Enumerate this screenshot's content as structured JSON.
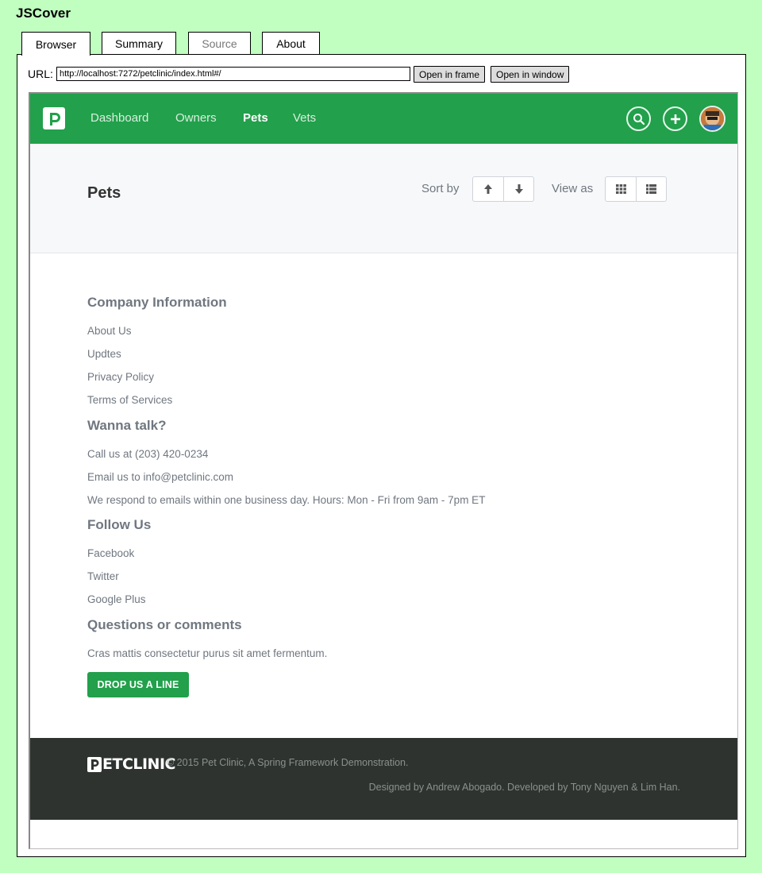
{
  "app_title": "JSCover",
  "tabs": [
    {
      "label": "Browser",
      "state": "active"
    },
    {
      "label": "Summary",
      "state": "normal"
    },
    {
      "label": "Source",
      "state": "disabled"
    },
    {
      "label": "About",
      "state": "normal"
    }
  ],
  "toolbar": {
    "url_label": "URL:",
    "url_value": "http://localhost:7272/petclinic/index.html#/",
    "open_frame_label": "Open in frame",
    "open_window_label": "Open in window"
  },
  "site": {
    "brand_color": "#22a04b",
    "nav": {
      "links": [
        "Dashboard",
        "Owners",
        "Pets",
        "Vets"
      ],
      "active": "Pets",
      "icons": [
        "search-icon",
        "plus-icon",
        "user-avatar"
      ]
    },
    "header": {
      "title": "Pets",
      "sort_label": "Sort by",
      "view_label": "View as",
      "sort_icons": [
        "arrow-up-icon",
        "arrow-down-icon"
      ],
      "view_icons": [
        "grid-view-icon",
        "list-view-icon"
      ]
    },
    "footer": {
      "company": {
        "heading": "Company Information",
        "links": [
          "About Us",
          "Updtes",
          "Privacy Policy",
          "Terms of Services"
        ]
      },
      "talk": {
        "heading": "Wanna talk?",
        "lines": [
          "Call us at (203) 420-0234",
          "Email us to info@petclinic.com",
          "We respond to emails within one business day. Hours: Mon - Fri from 9am - 7pm ET"
        ]
      },
      "follow": {
        "heading": "Follow Us",
        "links": [
          "Facebook",
          "Twitter",
          "Google Plus"
        ]
      },
      "questions": {
        "heading": "Questions or comments",
        "text": "Cras mattis consectetur purus sit amet fermentum.",
        "button": "DROP US A LINE"
      }
    },
    "bottom": {
      "brand_text": "ETCLINIC",
      "copyright": "© 2015 Pet Clinic, A Spring Framework Demonstration.",
      "credits": "Designed by Andrew Abogado. Developed by Tony Nguyen & Lim Han."
    }
  }
}
